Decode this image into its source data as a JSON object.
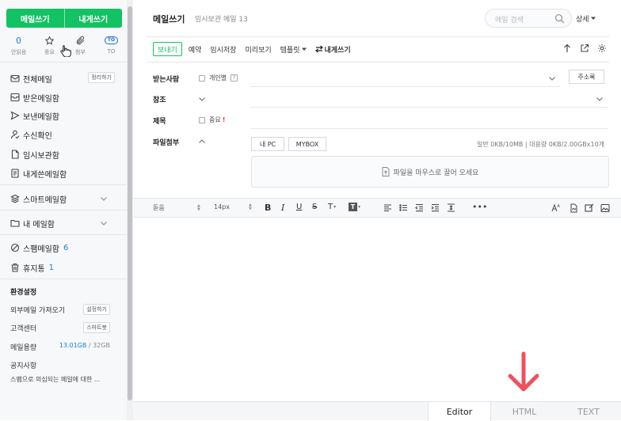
{
  "sidebar": {
    "compose": "메일쓰기",
    "self_compose": "내게쓰기",
    "quick": {
      "unread_count": "0",
      "unread": "안읽음",
      "important": "중요",
      "attachment": "첨부",
      "to_icon": "TO",
      "to": "TO"
    },
    "nav": {
      "all": "전체메일",
      "organize": "정리하기",
      "inbox": "받은메일함",
      "sent": "보낸메일함",
      "receipt": "수신확인",
      "drafts": "임시보관함",
      "self": "내게쓴메일함",
      "smart": "스마트메일함",
      "my": "내 메일함",
      "spam": "스팸메일함",
      "spam_count": "6",
      "trash": "휴지통",
      "trash_count": "1"
    },
    "settings": {
      "title": "환경설정",
      "external": "외부메일 가져오기",
      "external_btn": "설정하기",
      "support": "고객센터",
      "support_btn": "스마트봇",
      "usage": "메일용량",
      "usage_used": "13.01GB",
      "usage_sep": " / ",
      "usage_total": "32GB",
      "notice": "공지사항",
      "notice_text": "스팸으로 의심되는 메일에 대한 ..."
    }
  },
  "header": {
    "title": "메일쓰기",
    "draft": "임시보관 메일 13",
    "search_placeholder": "메일 검색",
    "detail": "상세"
  },
  "toolbar": {
    "send": "보내기",
    "reserve": "예약",
    "save": "임시저장",
    "preview": "미리보기",
    "template": "템플릿",
    "self": "내게쓰기"
  },
  "form": {
    "to": "받는사람",
    "individual": "개인별",
    "address_book": "주소록",
    "cc": "참조",
    "subject": "제목",
    "important": "중요",
    "attach": "파일첨부",
    "my_pc": "내 PC",
    "mybox": "MYBOX",
    "attach_info": "일반 0KB/10MB | 대용량 0KB/2.00GBx10개",
    "drop": "파일을 마우스로 끌어 오세요"
  },
  "editor": {
    "font": "돋움",
    "size": "14px"
  },
  "modes": {
    "editor": "Editor",
    "html": "HTML",
    "text": "TEXT"
  },
  "colors": {
    "accent": "#13c263",
    "link": "#1a7fe0",
    "arrow": "#f0505e"
  }
}
